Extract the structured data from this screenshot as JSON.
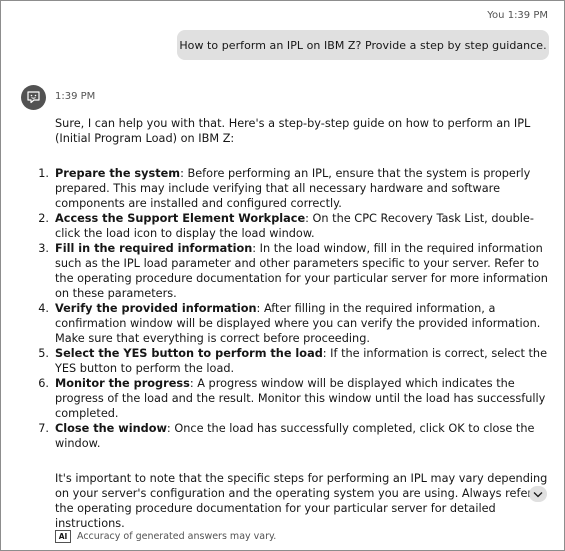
{
  "user_message": {
    "sender": "You",
    "time": "1:39 PM",
    "text": "How to perform an IPL on IBM Z? Provide a step by step guidance."
  },
  "bot_message": {
    "avatar_icon": "chat-bot-icon",
    "time": "1:39 PM",
    "intro": "Sure, I can help you with that. Here's a step-by-step guide on how to perform an IPL (Initial Program Load) on IBM Z:",
    "steps": [
      {
        "num": "1.",
        "title": "Prepare the system",
        "text": ": Before performing an IPL, ensure that the system is properly prepared. This may include verifying that all necessary hardware and software components are installed and configured correctly."
      },
      {
        "num": "2.",
        "title": "Access the Support Element Workplace",
        "text": ": On the CPC Recovery Task List, double-click the load icon to display the load window."
      },
      {
        "num": "3.",
        "title": "Fill in the required information",
        "text": ": In the load window, fill in the required information such as the IPL load parameter and other parameters specific to your server. Refer to the operating procedure documentation for your particular server for more information on these parameters."
      },
      {
        "num": "4.",
        "title": "Verify the provided information",
        "text": ": After filling in the required information, a confirmation window will be displayed where you can verify the provided information. Make sure that everything is correct before proceeding."
      },
      {
        "num": "5.",
        "title": "Select the YES button to perform the load",
        "text": ": If the information is correct, select the YES button to perform the load."
      },
      {
        "num": "6.",
        "title": "Monitor the progress",
        "text": ": A progress window will be displayed which indicates the progress of the load and the result. Monitor this window until the load has successfully completed."
      },
      {
        "num": "7.",
        "title": "Close the window",
        "text": ": Once the load has successfully completed, click OK to close the window."
      }
    ],
    "closing": "It's important to note that the specific steps for performing an IPL may vary depending on your server's configuration and the operating system you are using. Always refer to the operating procedure documentation for your particular server for detailed instructions."
  },
  "scroll_icon": "chevron-down-icon",
  "footer": {
    "badge": "AI",
    "text": "Accuracy of generated answers may vary."
  }
}
